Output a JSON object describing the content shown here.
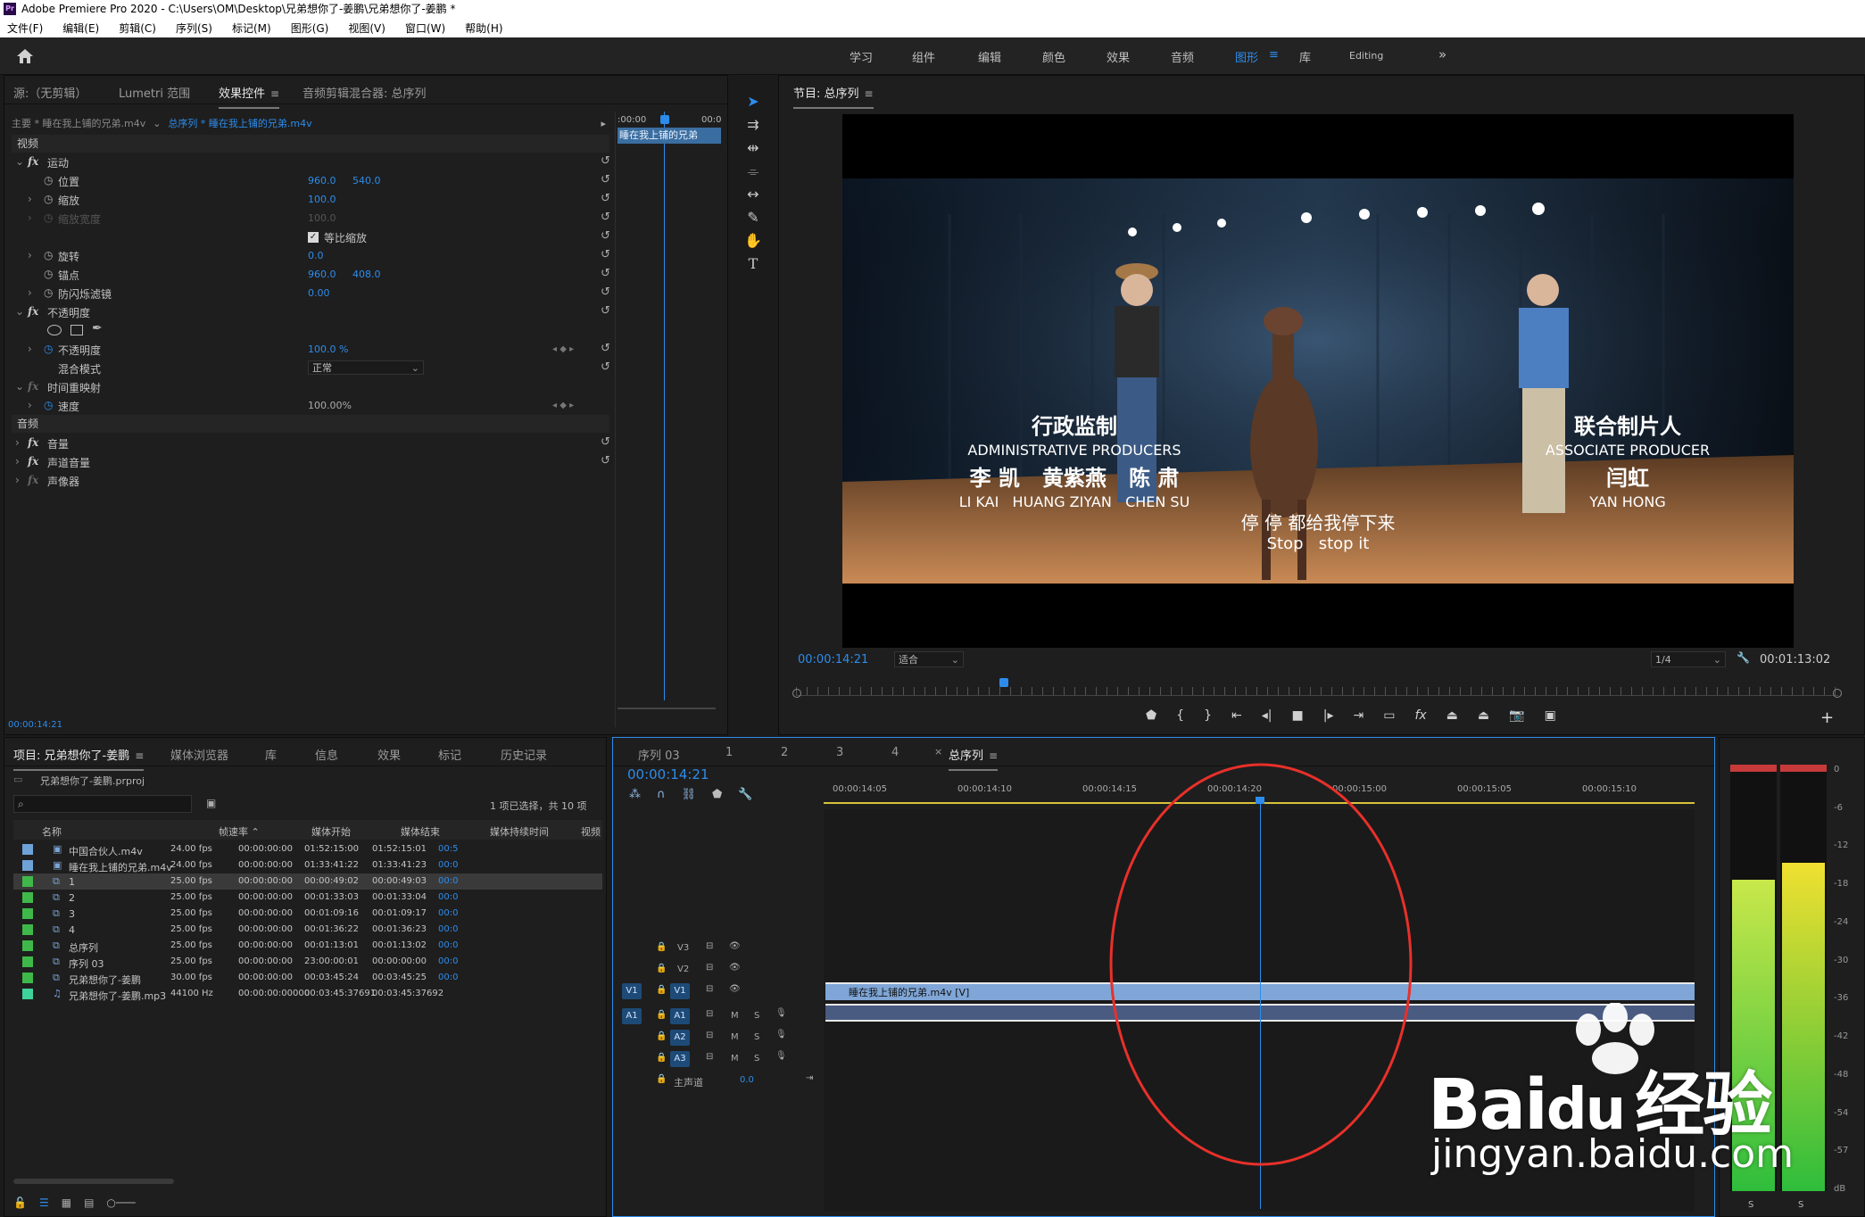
{
  "title_bar": "Adobe Premiere Pro 2020 - C:\\Users\\OM\\Desktop\\兄弟想你了-姜鹏\\兄弟想你了-姜鹏 *",
  "menu": [
    "文件(F)",
    "编辑(E)",
    "剪辑(C)",
    "序列(S)",
    "标记(M)",
    "图形(G)",
    "视图(V)",
    "窗口(W)",
    "帮助(H)"
  ],
  "workspaces": [
    "学习",
    "组件",
    "编辑",
    "颜色",
    "效果",
    "音频",
    "图形",
    "库",
    "Editing"
  ],
  "workspace_active": "图形",
  "more_label": "»",
  "source_tabs": [
    "源:（无剪辑）",
    "Lumetri 范围",
    "效果控件",
    "音频剪辑混合器: 总序列"
  ],
  "effect_controls": {
    "master_clip": "主要 * 睡在我上铺的兄弟.m4v",
    "sequence_clip": "总序列 * 睡在我上铺的兄弟.m4v",
    "mini_timecode": ":00:00",
    "mini_timecode2": "00:0",
    "mini_clip": "睡在我上铺的兄弟",
    "video_header": "视频",
    "audio_header": "音频",
    "motion": "运动",
    "position": "位置",
    "position_x": "960.0",
    "position_y": "540.0",
    "scale": "缩放",
    "scale_v": "100.0",
    "scale_width": "缩放宽度",
    "scale_width_v": "100.0",
    "uniform_scale": "等比缩放",
    "rotation": "旋转",
    "rotation_v": "0.0",
    "anchor": "锚点",
    "anchor_x": "960.0",
    "anchor_y": "408.0",
    "flicker": "防闪烁滤镜",
    "flicker_v": "0.00",
    "opacity_fx": "不透明度",
    "opacity": "不透明度",
    "opacity_v": "100.0 %",
    "blend_mode": "混合模式",
    "blend_v": "正常",
    "time_remap": "时间重映射",
    "speed": "速度",
    "speed_v": "100.00%",
    "volume": "音量",
    "channel_volume": "声道音量",
    "panner": "声像器",
    "timecode": "00:00:14:21"
  },
  "program": {
    "title": "节目: 总序列",
    "timecode": "00:00:14:21",
    "fit": "适合",
    "quality": "1/4",
    "duration": "00:01:13:02",
    "credits": {
      "left_cn": "行政监制",
      "left_en": "ADMINISTRATIVE PRODUCERS",
      "left_names_cn": "李 凯   黄紫燕   陈 肃",
      "left_names_en": "LI KAI   HUANG ZIYAN   CHEN SU",
      "right_cn": "联合制片人",
      "right_en": "ASSOCIATE PRODUCER",
      "right_name_cn": "闫虹",
      "right_name_en": "YAN HONG",
      "sub_cn": "停 停 都给我停下来",
      "sub_en": "Stop   stop it"
    }
  },
  "project": {
    "tabs": [
      "项目: 兄弟想你了-姜鹏",
      "媒体浏览器",
      "库",
      "信息",
      "效果",
      "标记",
      "历史记录"
    ],
    "file": "兄弟想你了-姜鹏.prproj",
    "search_placeholder": "",
    "selection_info": "1 项已选择，共 10 项",
    "columns": [
      "名称",
      "帧速率",
      "媒体开始",
      "媒体结束",
      "媒体持续时间",
      "视频"
    ],
    "rows": [
      {
        "name": "中国合伙人.m4v",
        "fps": "24.00 fps",
        "start": "00:00:00:00",
        "end": "01:52:15:00",
        "dur": "01:52:15:01",
        "v": "00:5",
        "color": "#6fa2d8",
        "kind": "clip"
      },
      {
        "name": "睡在我上铺的兄弟.m4v",
        "fps": "24.00 fps",
        "start": "00:00:00:00",
        "end": "01:33:41:22",
        "dur": "01:33:41:23",
        "v": "00:0",
        "color": "#6fa2d8",
        "kind": "clip"
      },
      {
        "name": "1",
        "fps": "25.00 fps",
        "start": "00:00:00:00",
        "end": "00:00:49:02",
        "dur": "00:00:49:03",
        "v": "00:0",
        "color": "#3fb84a",
        "kind": "seq"
      },
      {
        "name": "2",
        "fps": "25.00 fps",
        "start": "00:00:00:00",
        "end": "00:01:33:03",
        "dur": "00:01:33:04",
        "v": "00:0",
        "color": "#3fb84a",
        "kind": "seq"
      },
      {
        "name": "3",
        "fps": "25.00 fps",
        "start": "00:00:00:00",
        "end": "00:01:09:16",
        "dur": "00:01:09:17",
        "v": "00:0",
        "color": "#3fb84a",
        "kind": "seq"
      },
      {
        "name": "4",
        "fps": "25.00 fps",
        "start": "00:00:00:00",
        "end": "00:01:36:22",
        "dur": "00:01:36:23",
        "v": "00:0",
        "color": "#3fb84a",
        "kind": "seq"
      },
      {
        "name": "总序列",
        "fps": "25.00 fps",
        "start": "00:00:00:00",
        "end": "00:01:13:01",
        "dur": "00:01:13:02",
        "v": "00:0",
        "color": "#3fb84a",
        "kind": "seq"
      },
      {
        "name": "序列 03",
        "fps": "25.00 fps",
        "start": "00:00:00:00",
        "end": "23:00:00:01",
        "dur": "00:00:00:00",
        "v": "00:0",
        "color": "#3fb84a",
        "kind": "seq"
      },
      {
        "name": "兄弟想你了-姜鹏",
        "fps": "30.00 fps",
        "start": "00:00:00:00",
        "end": "00:03:45:24",
        "dur": "00:03:45:25",
        "v": "00:0",
        "color": "#3fb84a",
        "kind": "seq"
      },
      {
        "name": "兄弟想你了-姜鹏.mp3",
        "fps": "44100 Hz",
        "start": "00:00:00:00000",
        "end": "00:03:45:37691",
        "dur": "00:03:45:37692",
        "v": "",
        "color": "#3ed39a",
        "kind": "audio"
      }
    ]
  },
  "timeline": {
    "tabs": [
      "序列 03",
      "1",
      "2",
      "3",
      "4",
      "总序列"
    ],
    "timecode": "00:00:14:21",
    "ruler": [
      "00:00:14:05",
      "00:00:14:10",
      "00:00:14:15",
      "00:00:14:20",
      "00:00:15:00",
      "00:00:15:05",
      "00:00:15:10"
    ],
    "tracks_v": [
      "V3",
      "V2",
      "V1"
    ],
    "tracks_a": [
      "A1",
      "A2",
      "A3"
    ],
    "src_v": "V1",
    "src_a": "A1",
    "master": "主声道",
    "master_v": "0.0",
    "clip_v1": "睡在我上铺的兄弟.m4v [V]",
    "mute": "M",
    "solo": "S"
  },
  "meters": {
    "scale": [
      "0",
      "-6",
      "-12",
      "-18",
      "-24",
      "-30",
      "-36",
      "-42",
      "-48",
      "-54",
      "-57",
      "dB"
    ],
    "solo_labels": [
      "S",
      "S"
    ],
    "left_level": 0.73,
    "right_level": 0.77
  },
  "watermark": {
    "brand_en": "Bai",
    "brand_du": "du",
    "brand_cn": "经验",
    "url": "jingyan.baidu.com"
  },
  "colors": {
    "accent": "#2d8ceb",
    "panel": "#1e1e1e",
    "clip_v": "#7fa6d7",
    "clip_a": "#4a5b82",
    "circle": "#e8302a"
  }
}
